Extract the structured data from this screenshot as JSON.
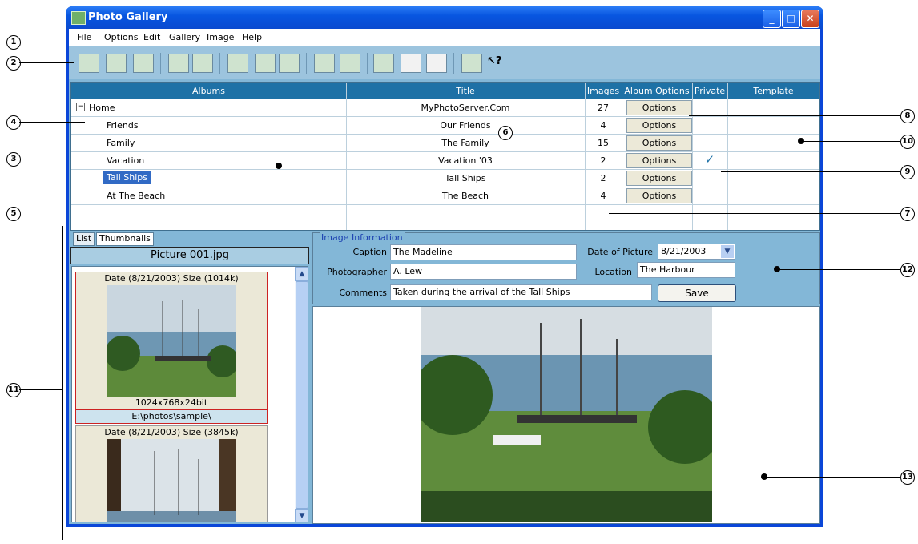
{
  "window": {
    "title": "Photo Gallery"
  },
  "menu": [
    "File",
    "Options",
    "Edit",
    "Gallery",
    "Image",
    "Help"
  ],
  "grid": {
    "headers": [
      "Albums",
      "Title",
      "Images",
      "Album Options",
      "Private",
      "Template"
    ],
    "rows": [
      {
        "album": "Home",
        "title": "MyPhotoServer.Com",
        "images": "27",
        "option": "Options",
        "private": false
      },
      {
        "album": "Friends",
        "title": "Our Friends",
        "images": "4",
        "option": "Options",
        "private": false
      },
      {
        "album": "Family",
        "title": "The Family",
        "images": "15",
        "option": "Options",
        "private": false
      },
      {
        "album": "Vacation",
        "title": "Vacation '03",
        "images": "2",
        "option": "Options",
        "private": true
      },
      {
        "album": "Tall Ships",
        "title": "Tall Ships",
        "images": "2",
        "option": "Options",
        "private": false
      },
      {
        "album": "At The Beach",
        "title": "The Beach",
        "images": "4",
        "option": "Options",
        "private": false
      }
    ],
    "tree_toggle": "−",
    "check_mark": "✓"
  },
  "tabs": [
    "List",
    "Thumbnails"
  ],
  "picture_name": "Picture 001.jpg",
  "thumbnails": [
    {
      "header": "Date (8/21/2003) Size (1014k)",
      "footer": "1024x768x24bit",
      "path": "E:\\photos\\sample\\"
    },
    {
      "header": "Date (8/21/2003) Size (3845k)"
    }
  ],
  "info": {
    "legend": "Image Information",
    "caption_label": "Caption",
    "caption": "The Madeline",
    "photographer_label": "Photographer",
    "photographer": "A. Lew",
    "comments_label": "Comments",
    "comments": "Taken during the arrival of the Tall Ships",
    "date_label": "Date of Picture",
    "date": "8/21/2003",
    "location_label": "Location",
    "location": "The Harbour",
    "save": "Save"
  },
  "callouts": [
    "1",
    "2",
    "3",
    "4",
    "5",
    "6",
    "7",
    "8",
    "9",
    "10",
    "11",
    "12",
    "13"
  ],
  "colors": {
    "title_bar": "#0a4bd0",
    "header": "#1e71a6",
    "panel": "#83b7d7",
    "selection": "#316ac5"
  }
}
